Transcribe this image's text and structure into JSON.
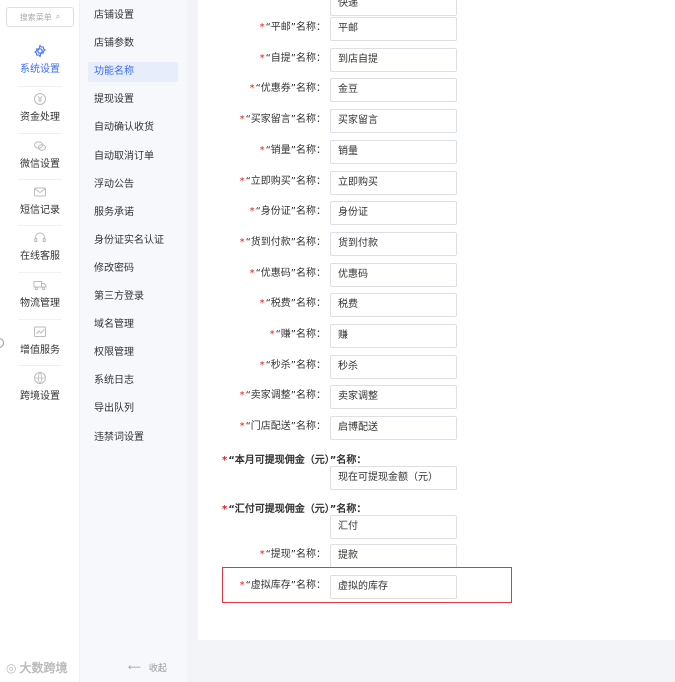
{
  "search": {
    "placeholder": "搜索菜单"
  },
  "rail": [
    {
      "label": "系统设置",
      "icon": "gear-icon",
      "active": true
    },
    {
      "label": "资金处理",
      "icon": "yen-icon"
    },
    {
      "label": "微信设置",
      "icon": "wechat-icon"
    },
    {
      "label": "短信记录",
      "icon": "message-icon"
    },
    {
      "label": "在线客服",
      "icon": "headset-icon"
    },
    {
      "label": "物流管理",
      "icon": "truck-icon"
    },
    {
      "label": "增值服务",
      "icon": "chart-icon"
    },
    {
      "label": "跨境设置",
      "icon": "globe-icon"
    }
  ],
  "submenu": [
    {
      "label": "店铺设置"
    },
    {
      "label": "店铺参数"
    },
    {
      "label": "功能名称",
      "active": true
    },
    {
      "label": "提现设置"
    },
    {
      "label": "自动确认收货"
    },
    {
      "label": "自动取消订单"
    },
    {
      "label": "浮动公告"
    },
    {
      "label": "服务承诺"
    },
    {
      "label": "身份证实名认证"
    },
    {
      "label": "修改密码"
    },
    {
      "label": "第三方登录"
    },
    {
      "label": "域名管理"
    },
    {
      "label": "权限管理"
    },
    {
      "label": "系统日志"
    },
    {
      "label": "导出队列"
    },
    {
      "label": "违禁词设置"
    }
  ],
  "form": {
    "top_partial_value": "快递",
    "rows": [
      {
        "label": "“平邮”名称：",
        "value": "平邮"
      },
      {
        "label": "“自提”名称：",
        "value": "到店自提"
      },
      {
        "label": "“优惠券”名称：",
        "value": "金豆"
      },
      {
        "label": "“买家留言”名称：",
        "value": "买家留言"
      },
      {
        "label": "“销量”名称：",
        "value": "销量"
      },
      {
        "label": "“立即购买”名称：",
        "value": "立即购买"
      },
      {
        "label": "“身份证”名称：",
        "value": "身份证"
      },
      {
        "label": "“货到付款”名称：",
        "value": "货到付款"
      },
      {
        "label": "“优惠码”名称：",
        "value": "优惠码"
      },
      {
        "label": "“税费”名称：",
        "value": "税费"
      },
      {
        "label": "“赚”名称：",
        "value": "赚"
      },
      {
        "label": "“秒杀”名称：",
        "value": "秒杀"
      },
      {
        "label": "“卖家调整”名称：",
        "value": "卖家调整"
      },
      {
        "label": "“门店配送”名称：",
        "value": "启博配送"
      }
    ],
    "block1": {
      "label": "“本月可提现佣金（元）”名称：",
      "value": "现在可提现金额（元）"
    },
    "block2": {
      "label": "“汇付可提现佣金（元）”名称：",
      "value": "汇付"
    },
    "row_withdraw": {
      "label": "“提现”名称：",
      "value": "提款"
    },
    "row_virtual": {
      "label": "“虚拟库存”名称：",
      "value": "虚拟的库存"
    },
    "required_mark": "*"
  },
  "footer": {
    "brand": "大数跨境",
    "collapse_label": "收起"
  },
  "colors": {
    "accent": "#3b6cff",
    "required": "#e02020",
    "highlight": "#e0383e"
  }
}
